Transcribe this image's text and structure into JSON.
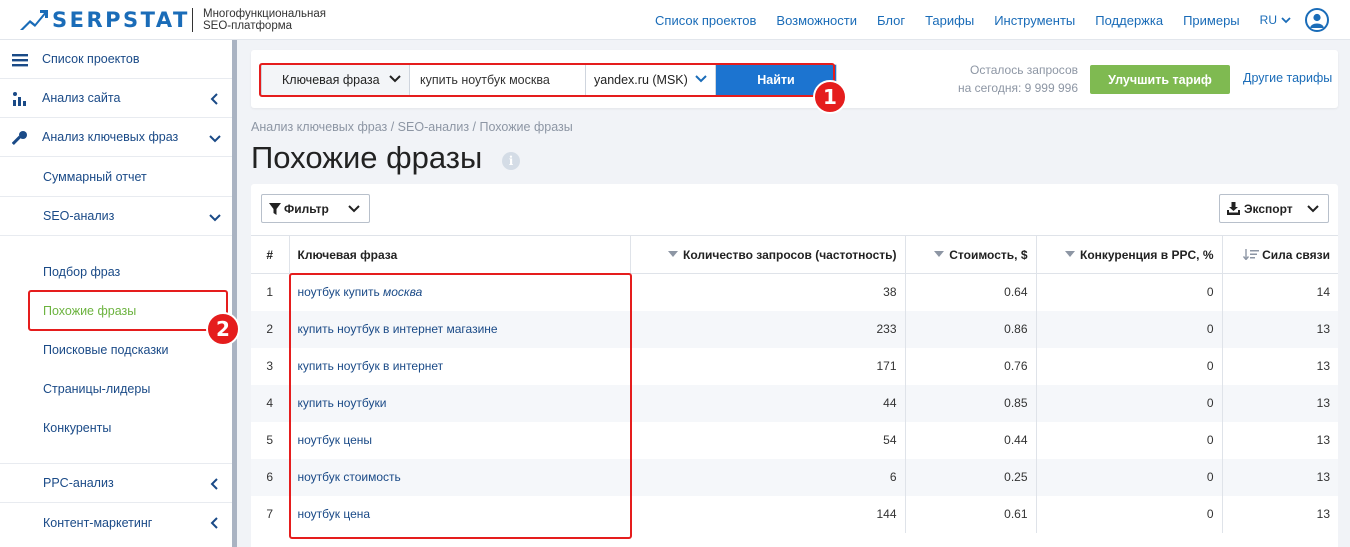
{
  "header": {
    "brand": "SERPSTAT",
    "tagline_line1": "Многофункциональная",
    "tagline_line2": "SEO-платформа",
    "nav": [
      "Список проектов",
      "Возможности",
      "Блог",
      "Тарифы",
      "Инструменты",
      "Поддержка",
      "Примеры"
    ],
    "lang": "RU"
  },
  "sidebar": {
    "items": [
      {
        "label": "Список проектов",
        "icon": "menu-icon"
      },
      {
        "label": "Анализ сайта",
        "icon": "chart-icon"
      },
      {
        "label": "Анализ ключевых фраз",
        "icon": "key-icon"
      },
      {
        "label": "Суммарный отчет"
      },
      {
        "label": "SEO-анализ"
      },
      {
        "label": "Подбор фраз"
      },
      {
        "label": "Похожие фразы"
      },
      {
        "label": "Поисковые подсказки"
      },
      {
        "label": "Страницы-лидеры"
      },
      {
        "label": "Конкуренты"
      },
      {
        "label": "PPC-анализ"
      },
      {
        "label": "Контент-маркетинг"
      }
    ]
  },
  "search": {
    "type_label": "Ключевая фраза",
    "query": "купить ноутбук москва",
    "database": "yandex.ru (MSK)",
    "button": "Найти",
    "quota_line1": "Осталось запросов",
    "quota_line2": "на сегодня: 9 999 996",
    "upgrade": "Улучшить тариф",
    "other_plans": "Другие тарифы"
  },
  "annotations": {
    "badge1": "1",
    "badge2": "2"
  },
  "breadcrumb": "Анализ ключевых фраз / SEO-анализ / Похожие фразы",
  "page_title": "Похожие фразы",
  "info_glyph": "i",
  "toolbar": {
    "filter": "Фильтр",
    "export": "Экспорт"
  },
  "table": {
    "headers": [
      "#",
      "Ключевая фраза",
      "Количество запросов (частотность)",
      "Стоимость, $",
      "Конкуренция в PPC, %",
      "Сила связи"
    ],
    "rows": [
      {
        "n": "1",
        "kw": "ноутбук купить ",
        "kw_em": "москва",
        "vol": "38",
        "cost": "0.64",
        "comp": "0",
        "rel": "14"
      },
      {
        "n": "2",
        "kw": "купить ноутбук в интернет магазине",
        "kw_em": "",
        "vol": "233",
        "cost": "0.86",
        "comp": "0",
        "rel": "13"
      },
      {
        "n": "3",
        "kw": "купить ноутбук в интернет",
        "kw_em": "",
        "vol": "171",
        "cost": "0.76",
        "comp": "0",
        "rel": "13"
      },
      {
        "n": "4",
        "kw": "купить ноутбуки",
        "kw_em": "",
        "vol": "44",
        "cost": "0.85",
        "comp": "0",
        "rel": "13"
      },
      {
        "n": "5",
        "kw": "ноутбук цены",
        "kw_em": "",
        "vol": "54",
        "cost": "0.44",
        "comp": "0",
        "rel": "13"
      },
      {
        "n": "6",
        "kw": "ноутбук стоимость",
        "kw_em": "",
        "vol": "6",
        "cost": "0.25",
        "comp": "0",
        "rel": "13"
      },
      {
        "n": "7",
        "kw": "ноутбук цена",
        "kw_em": "",
        "vol": "144",
        "cost": "0.61",
        "comp": "0",
        "rel": "13"
      }
    ]
  },
  "colors": {
    "brand_blue": "#1a6cb8",
    "accent_green": "#7fba51",
    "annotation_red": "#e51d1d"
  }
}
